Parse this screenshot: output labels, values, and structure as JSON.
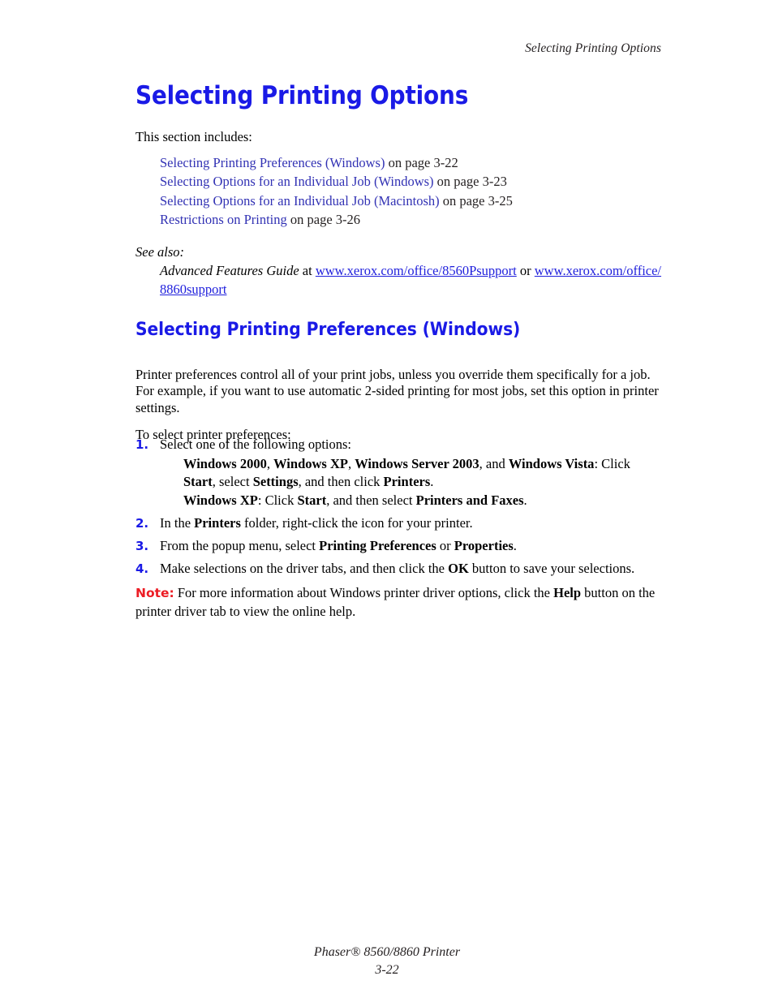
{
  "header": {
    "running_header": "Selecting Printing Options"
  },
  "main": {
    "title": "Selecting Printing Options",
    "intro": "This section includes:",
    "toc": [
      {
        "link": "Selecting Printing Preferences (Windows)",
        "suffix": " on page 3-22"
      },
      {
        "link": "Selecting Options for an Individual Job (Windows)",
        "suffix": " on page 3-23"
      },
      {
        "link": "Selecting Options for an Individual Job (Macintosh)",
        "suffix": " on page 3-25"
      },
      {
        "link": "Restrictions on Printing",
        "suffix": " on page 3-26"
      }
    ],
    "see_also": {
      "label": "See also:",
      "guide": "Advanced Features Guide",
      "at": " at ",
      "url_1": "www.xerox.com/office/8560Psupport",
      "or": " or ",
      "url_2": "www.xerox.com/office/8860support"
    },
    "subtitle": "Selecting Printing Preferences (Windows)",
    "paragraph_1": "Printer preferences control all of your print jobs, unless you override them specifically for a job. For example, if you want to use automatic 2-sided printing for most jobs, set this option in printer settings.",
    "paragraph_2": "To select printer preferences:",
    "steps": [
      {
        "num": "1.",
        "text": "Select one of the following options:",
        "substeps": [
          {
            "p1_b": "Windows 2000",
            "p2": ", ",
            "p3_b": "Windows XP",
            "p4": ", ",
            "p5_b": "Windows Server 2003",
            "p6": ", and ",
            "p7_b": "Windows Vista",
            "p8": ": Click ",
            "p9_b": "Start",
            "p10": ", select ",
            "p11_b": "Settings",
            "p12": ", and then click ",
            "p13_b": "Printers",
            "p14": "."
          },
          {
            "p1_b": "Windows XP",
            "p2": ": Click ",
            "p3_b": "Start",
            "p4": ", and then select ",
            "p5_b": "Printers and Faxes",
            "p6": "."
          }
        ]
      },
      {
        "num": "2.",
        "pre": "In the ",
        "bold": "Printers",
        "post": " folder, right-click the icon for your printer."
      },
      {
        "num": "3.",
        "pre": "From the popup menu, select ",
        "bold": "Printing Preferences",
        "mid": " or ",
        "bold2": "Properties",
        "post": "."
      },
      {
        "num": "4.",
        "pre": "Make selections on the driver tabs, and then click the ",
        "bold": "OK",
        "post": " button to save your selections."
      }
    ],
    "note": {
      "label": "Note:",
      "pre": " For more information about Windows printer driver options, click the ",
      "bold": "Help",
      "post": " button on the printer driver tab to view the online help."
    }
  },
  "footer": {
    "product": "Phaser® 8560/8860 Printer",
    "page_number": "3-22"
  },
  "colors": {
    "heading_blue": "#1a1ae6",
    "toc_link_blue": "#3232b4",
    "url_blue": "#1f1fdc",
    "note_red": "#ec1c24",
    "body_black": "#231f20"
  }
}
